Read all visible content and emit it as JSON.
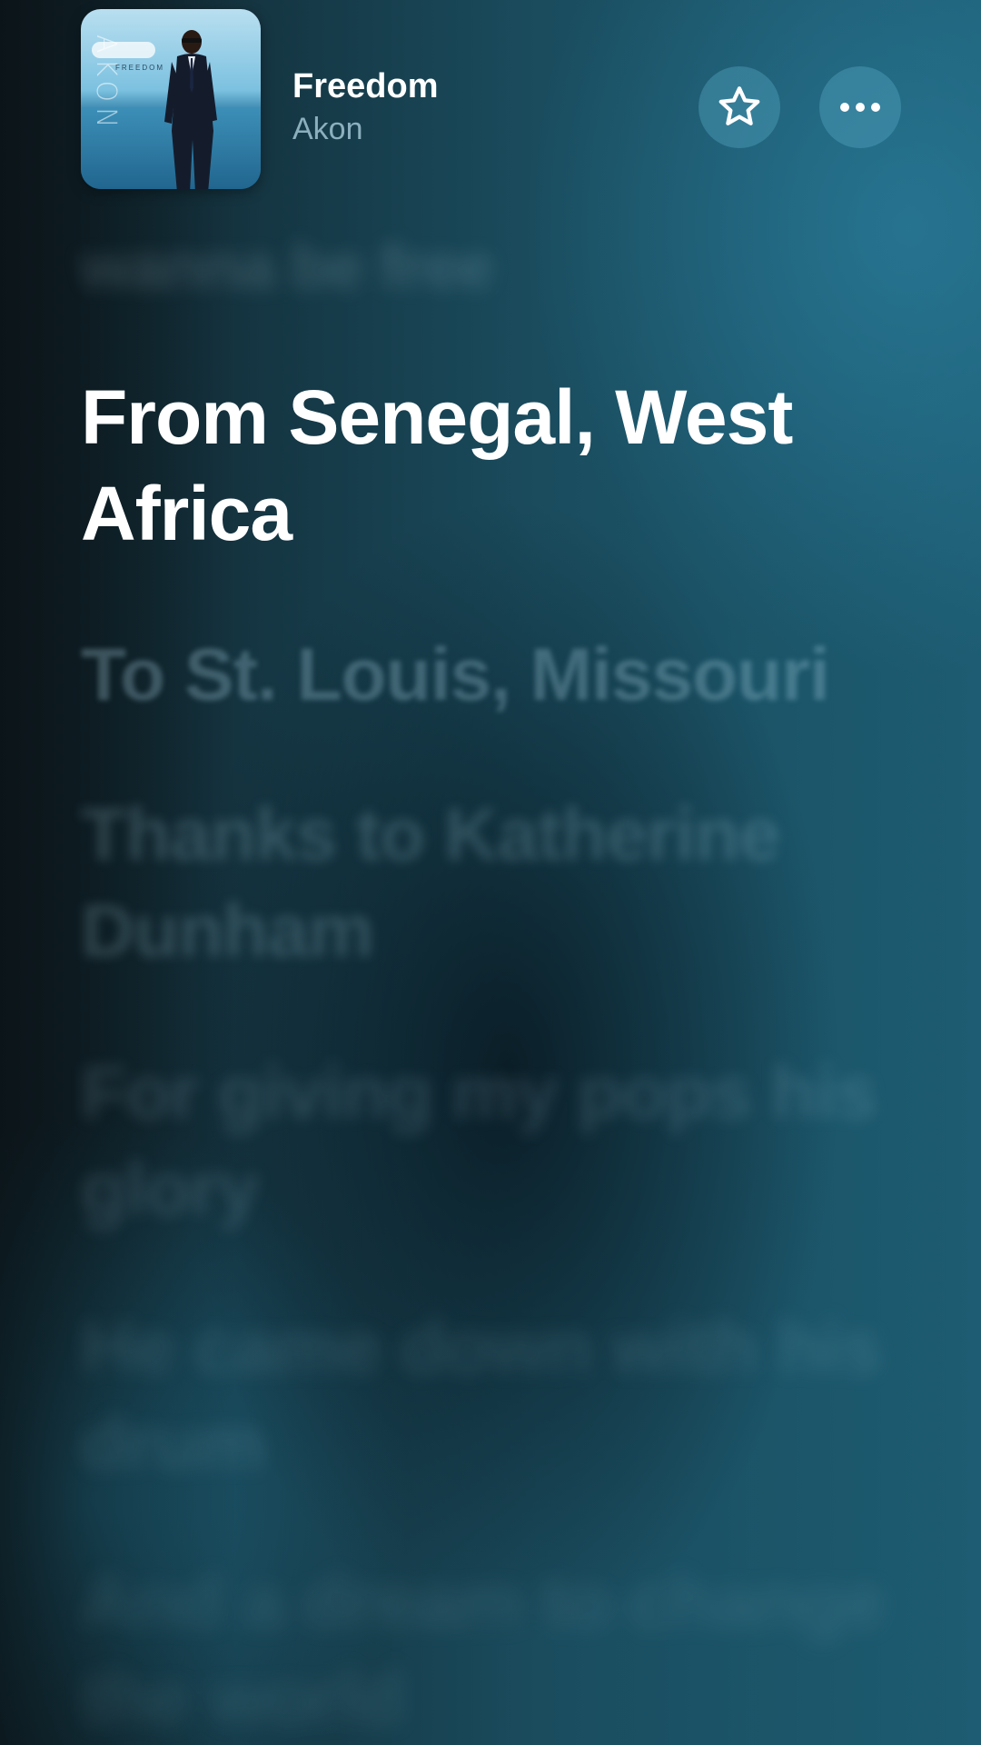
{
  "now_playing": {
    "title": "Freedom",
    "artist": "Akon",
    "album_art": {
      "vertical_text": "AKON",
      "small_title": "FREEDOM"
    }
  },
  "actions": {
    "favorite_icon": "star-icon",
    "more_icon": "ellipsis-icon"
  },
  "lyrics": {
    "previous_line": "wanna be free",
    "current_line": "From Senegal, West Africa",
    "upcoming": [
      "To St. Louis, Missouri",
      "Thanks to Katherine Dunham",
      "For giving my pops his glory",
      "He came down with his drum",
      "And a dream to change the world"
    ]
  },
  "colors": {
    "background_dark": "#0e1c22",
    "background_teal": "#1d5c72",
    "button_fill": "#3a8fae",
    "text_active": "#ffffff",
    "artist_text": "#b4d7e6"
  }
}
